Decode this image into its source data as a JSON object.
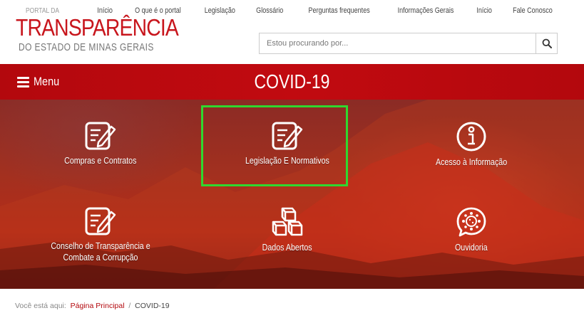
{
  "logo": {
    "top_text": "PORTAL DA",
    "main_text": "TRANSPARÊNCIA",
    "sub_text": "DO ESTADO DE MINAS GERAIS"
  },
  "topnav": [
    "Início",
    "O que é o portal",
    "Legislação",
    "Glossário",
    "Perguntas frequentes",
    "Informações Gerais",
    "Início",
    "Fale Conosco"
  ],
  "search": {
    "placeholder": "Estou procurando por...",
    "icon": "search-icon"
  },
  "menu": {
    "label": "Menu",
    "icon": "hamburger-icon"
  },
  "page_title": "COVID-19",
  "tiles": [
    {
      "label": "Compras e Contratos",
      "icon": "edit-document-icon"
    },
    {
      "label": "Legislação E Normativos",
      "icon": "edit-document-icon"
    },
    {
      "label": "Acesso à Informação",
      "icon": "info-icon"
    },
    {
      "label": "Conselho de Transparência e Combate a Corrupção",
      "icon": "edit-document-icon"
    },
    {
      "label": "Dados Abertos",
      "icon": "cubes-icon"
    },
    {
      "label": "Ouvidoria",
      "icon": "virus-speech-icon"
    }
  ],
  "breadcrumb": {
    "prefix": "Você está aqui:",
    "home": "Página Principal",
    "separator": "/",
    "current": "COVID-19"
  },
  "colors": {
    "brand_red": "#c8161d",
    "bar_red": "#b3080d",
    "highlight": "#2fd82f"
  }
}
